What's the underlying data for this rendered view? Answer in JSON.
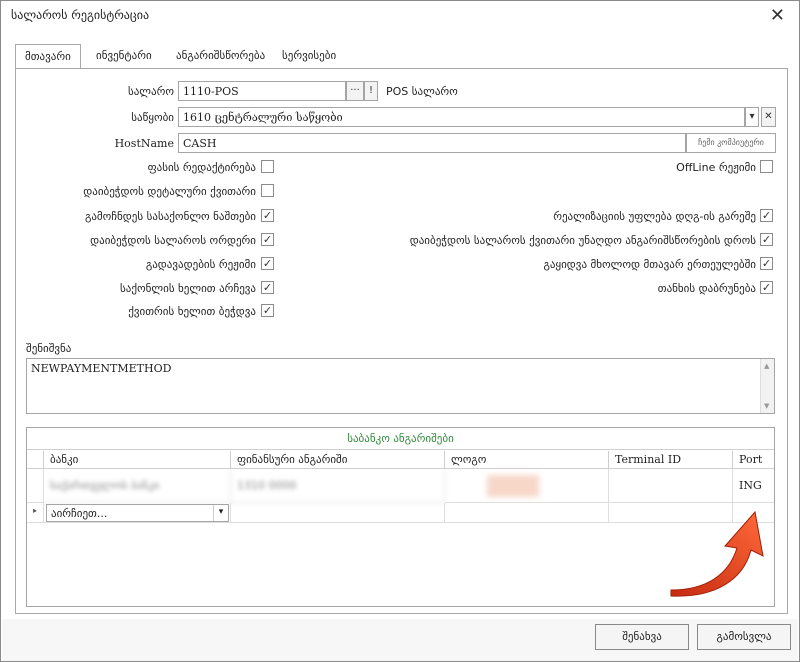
{
  "window": {
    "title": "სალაროს რეგისტრაცია",
    "close_glyph": "✕"
  },
  "tabs": [
    {
      "label": "მთავარი",
      "active": true
    },
    {
      "label": "ინვენტარი",
      "active": false
    },
    {
      "label": "ანგარიშსწორება",
      "active": false
    },
    {
      "label": "სერვისები",
      "active": false
    }
  ],
  "form": {
    "cash_register": {
      "label": "სალარო",
      "value": "1110-POS",
      "button_dots": "···",
      "button_excl": "!",
      "side_label": "POS სალარო"
    },
    "warehouse": {
      "label": "საწყობი",
      "value": "1610   ცენტრალური საწყობი",
      "dropdown_glyph": "▾",
      "clear_glyph": "✕"
    },
    "hostname": {
      "label": "HostName",
      "value": "CASH",
      "button_label": "ჩემი კომპიუტერი"
    }
  },
  "checkboxes_left": [
    {
      "label": "ფასის რედაქტირება",
      "checked": false
    },
    {
      "label": "დაიბეჭდოს დეტალური ქვითარი",
      "checked": false
    },
    {
      "label": "გამოჩნდეს სასაქონლო ნაშთები",
      "checked": true
    },
    {
      "label": "დაიბეჭდოს სალაროს ორდერი",
      "checked": true
    },
    {
      "label": "გადავადების რეჟიმი",
      "checked": true
    },
    {
      "label": "საქონლის ხელით არჩევა",
      "checked": true
    },
    {
      "label": "ქვითრის ხელით ბეჭდვა",
      "checked": true
    }
  ],
  "checkboxes_right": [
    {
      "label": "OffLine რეჟიმი",
      "checked": false
    },
    {
      "label": "რეალიზაციის უფლება დღგ-ის გარეშე",
      "checked": true
    },
    {
      "label": "დაიბეჭდოს სალაროს ქვითარი უნაღდო ანგარიშსწორების დროს",
      "checked": true
    },
    {
      "label": "გაყიდვა მხოლოდ მთავარ ერთეულებში",
      "checked": true
    },
    {
      "label": "თანხის დაბრუნება",
      "checked": true
    }
  ],
  "check_glyph": "✓",
  "notes": {
    "label": "შენიშვნა",
    "value": "NEWPAYMENTMETHOD"
  },
  "bank_grid": {
    "title": "საბანკო ანგარიშები",
    "columns": [
      "ბანკი",
      "ფინანსური ანგარიში",
      "ლოგო",
      "Terminal ID",
      "Port"
    ],
    "rows": [
      {
        "bank": "საქართველოს ბანკი",
        "account": "1310 0000",
        "logo": "",
        "terminal": "",
        "port": "ING"
      }
    ],
    "new_row": {
      "indicator": "▸",
      "bank_placeholder": "აირჩიეთ...",
      "dropdown_glyph": "▾"
    }
  },
  "buttons": {
    "save": "შენახვა",
    "exit": "გამოსვლა"
  },
  "colors": {
    "accent_green": "#2d8a3a",
    "arrow": "#e8401c"
  }
}
